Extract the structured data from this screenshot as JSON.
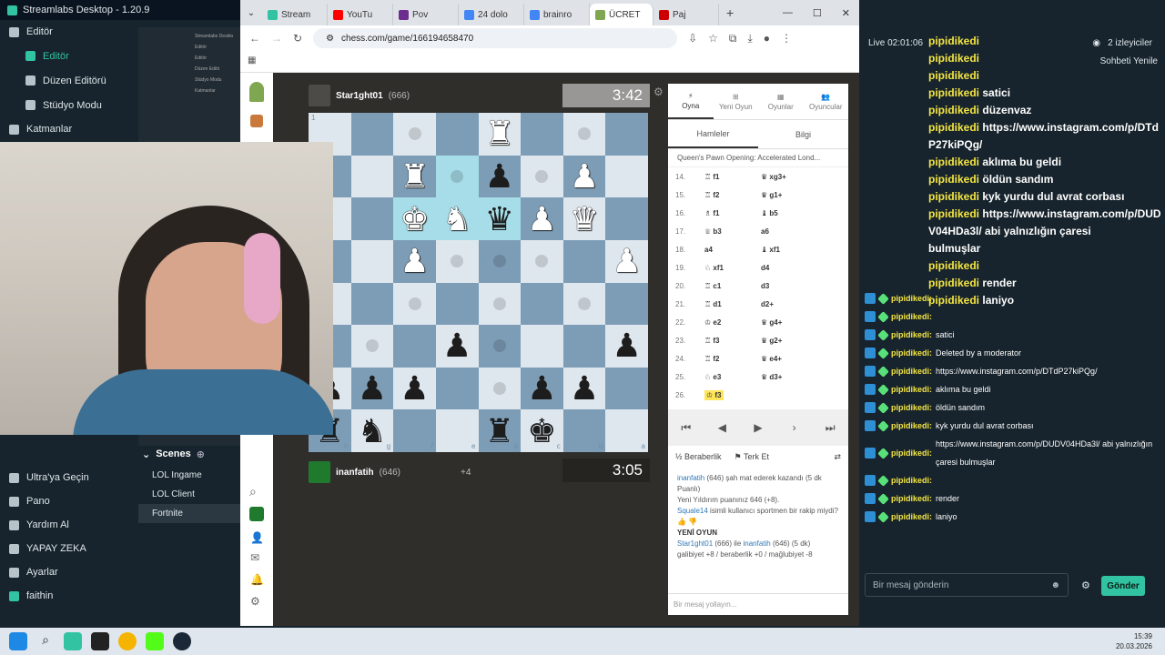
{
  "streamlabs": {
    "title": "Streamlabs Desktop - 1.20.9",
    "sections": [
      "Editör",
      "Katmanlar"
    ],
    "editor_items": [
      "Editör",
      "Düzen Editörü",
      "Stüdyo Modu"
    ],
    "bottom_items": [
      "Ultra'ya Geçin",
      "Pano",
      "Yardım Al",
      "YAPAY ZEKA",
      "Ayarlar"
    ],
    "user": "faithin",
    "scenes_title": "Scenes",
    "scenes": [
      "LOL Ingame",
      "LOL Client",
      "Fortnite"
    ],
    "preview_labels": [
      "Streamlabs Deskto",
      "Editör",
      "Editör",
      "Düzen Editö",
      "Stüdyo Modu",
      "Katmanlar"
    ]
  },
  "chrome": {
    "tabs": [
      {
        "label": "Stream",
        "color": "#31c3a2"
      },
      {
        "label": "YouTu",
        "color": "#ff0000"
      },
      {
        "label": "Pov",
        "color": "#6b2e8f"
      },
      {
        "label": "24 dolo",
        "color": "#4285f4"
      },
      {
        "label": "brainro",
        "color": "#4285f4"
      },
      {
        "label": "ÜCRET",
        "color": "#7fa650"
      },
      {
        "label": "Paj",
        "color": "#c00"
      }
    ],
    "url": "chess.com/game/166194658470"
  },
  "game": {
    "top_player": "Star1ght01",
    "top_rating": "(666)",
    "top_clock": "3:42",
    "bottom_player": "inanfatih",
    "bottom_rating": "(646)",
    "bottom_extra": "+4",
    "bottom_clock": "3:05",
    "rank_top": "1",
    "files": [
      "h",
      "g",
      "f",
      "e",
      "d",
      "c",
      "b",
      "a"
    ],
    "board": [
      [
        "",
        "",
        "dot",
        "",
        "♜w",
        "",
        "dot",
        ""
      ],
      [
        "",
        "",
        "♜w",
        "hldot",
        "♟b",
        "dot",
        "♟w",
        ""
      ],
      [
        "",
        "",
        "♚whl",
        "♞whl",
        "♛bhl",
        "♟w",
        "♛w",
        ""
      ],
      [
        "",
        "",
        "♟w",
        "dot",
        "dot",
        "dot",
        "",
        "♟w"
      ],
      [
        "",
        "",
        "dot",
        "",
        "dot",
        "",
        "dot",
        ""
      ],
      [
        "",
        "dot",
        "",
        "♟b",
        "dot",
        "",
        "",
        "♟b"
      ],
      [
        "♟b",
        "♟b",
        "♟b",
        "",
        "dot",
        "♟b",
        "♟b",
        ""
      ],
      [
        "♜b",
        "♞b",
        "",
        "",
        "♜b",
        "♚b",
        "",
        ""
      ]
    ]
  },
  "panel": {
    "tabs": [
      "Oyna",
      "Yeni Oyun",
      "Oyunlar",
      "Oyuncular"
    ],
    "sub_tabs": [
      "Hamleler",
      "Bilgi"
    ],
    "opening": "Queen's Pawn Opening: Accelerated Lond...",
    "moves": [
      {
        "n": "14.",
        "w": "♖ f1",
        "b": "♛ xg3+"
      },
      {
        "n": "15.",
        "w": "♖ f2",
        "b": "♛ g1+"
      },
      {
        "n": "16.",
        "w": "♗ f1",
        "b": "♝ b5"
      },
      {
        "n": "17.",
        "w": "♕ b3",
        "b": "a6"
      },
      {
        "n": "18.",
        "w": "a4",
        "b": "♝ xf1"
      },
      {
        "n": "19.",
        "w": "♘ xf1",
        "b": "d4"
      },
      {
        "n": "20.",
        "w": "♖ c1",
        "b": "d3"
      },
      {
        "n": "21.",
        "w": "♖ d1",
        "b": "d2+"
      },
      {
        "n": "22.",
        "w": "♔ e2",
        "b": "♛ g4+"
      },
      {
        "n": "23.",
        "w": "♖ f3",
        "b": "♛ g2+"
      },
      {
        "n": "24.",
        "w": "♖ f2",
        "b": "♛ e4+"
      },
      {
        "n": "25.",
        "w": "♘ e3",
        "b": "♛ d3+"
      },
      {
        "n": "26.",
        "w": "♔ f3",
        "b": ""
      }
    ],
    "draw": "Berabrelik",
    "draw_real": "Beraberlik",
    "resign": "Terk Et",
    "log": {
      "l1_user": "inanfatih",
      "l1_text": " (646) şah mat ederek kazandı (5 dk Puanlı)",
      "l2": "Yeni Yıldırım puanınız 646 (+8).",
      "l3_user": "Squale14",
      "l3_text": " isimli kullanıcı sportmen bir rakip miydi?",
      "new_game": "YENİ OYUN",
      "l4_user1": "Star1ght01",
      "l4_mid": " (666) ile ",
      "l4_user2": "inanfatih",
      "l4_tail": " (646) (5 dk)",
      "l5": "galibiyet +8 / beraberlik +0 / mağlubiyet -8"
    },
    "input_placeholder": "Bir mesaj yollayın..."
  },
  "chat": {
    "live": "Live 02:01:06",
    "viewers": "2 izleyiciler",
    "refresh": "Sohbeti Yenile",
    "big_msgs": [
      {
        "u": "pipidikedi",
        "t": ""
      },
      {
        "u": "pipidikedi",
        "t": ""
      },
      {
        "u": "pipidikedi",
        "t": ""
      },
      {
        "u": "pipidikedi",
        "t": "satici"
      },
      {
        "u": "pipidikedi",
        "t": "düzenvaz"
      },
      {
        "u": "pipidikedi",
        "t": "https://www.instagram.com/p/DTd"
      },
      {
        "u": "",
        "t": "P27kiPQg/"
      },
      {
        "u": "pipidikedi",
        "t": "aklıma bu geldi"
      },
      {
        "u": "pipidikedi",
        "t": "öldün sandım"
      },
      {
        "u": "pipidikedi",
        "t": "kyk yurdu dul avrat corbası"
      },
      {
        "u": "pipidikedi",
        "t": "https://www.instagram.com/p/DUD"
      },
      {
        "u": "",
        "t": "V04HDa3l/ abi yalnızlığın çaresi"
      },
      {
        "u": "",
        "t": "bulmuşlar"
      },
      {
        "u": "pipidikedi",
        "t": ""
      },
      {
        "u": "pipidikedi",
        "t": "render"
      },
      {
        "u": "pipidikedi",
        "t": "laniyo"
      }
    ],
    "small_msgs": [
      {
        "u": "pipidikedi:",
        "t": ""
      },
      {
        "u": "pipidikedi:",
        "t": ""
      },
      {
        "u": "pipidikedi:",
        "t": "satici"
      },
      {
        "u": "pipidikedi:",
        "t": "Deleted by a moderator"
      },
      {
        "u": "pipidikedi:",
        "t": "https://www.instagram.com/p/DTdP27kiPQg/"
      },
      {
        "u": "pipidikedi:",
        "t": "aklıma bu geldi"
      },
      {
        "u": "pipidikedi:",
        "t": "öldün sandım"
      },
      {
        "u": "pipidikedi:",
        "t": "kyk yurdu dul avrat corbası"
      },
      {
        "u": "pipidikedi:",
        "t": "https://www.instagram.com/p/DUDV04HDa3l/ abi yalnızlığın çaresi bulmuşlar"
      },
      {
        "u": "pipidikedi:",
        "t": ""
      },
      {
        "u": "pipidikedi:",
        "t": "render"
      },
      {
        "u": "pipidikedi:",
        "t": "laniyo"
      }
    ],
    "input_placeholder": "Bir mesaj gönderin",
    "send": "Gönder"
  },
  "taskbar": {
    "time": "15:39",
    "date": "20.03.2026"
  }
}
